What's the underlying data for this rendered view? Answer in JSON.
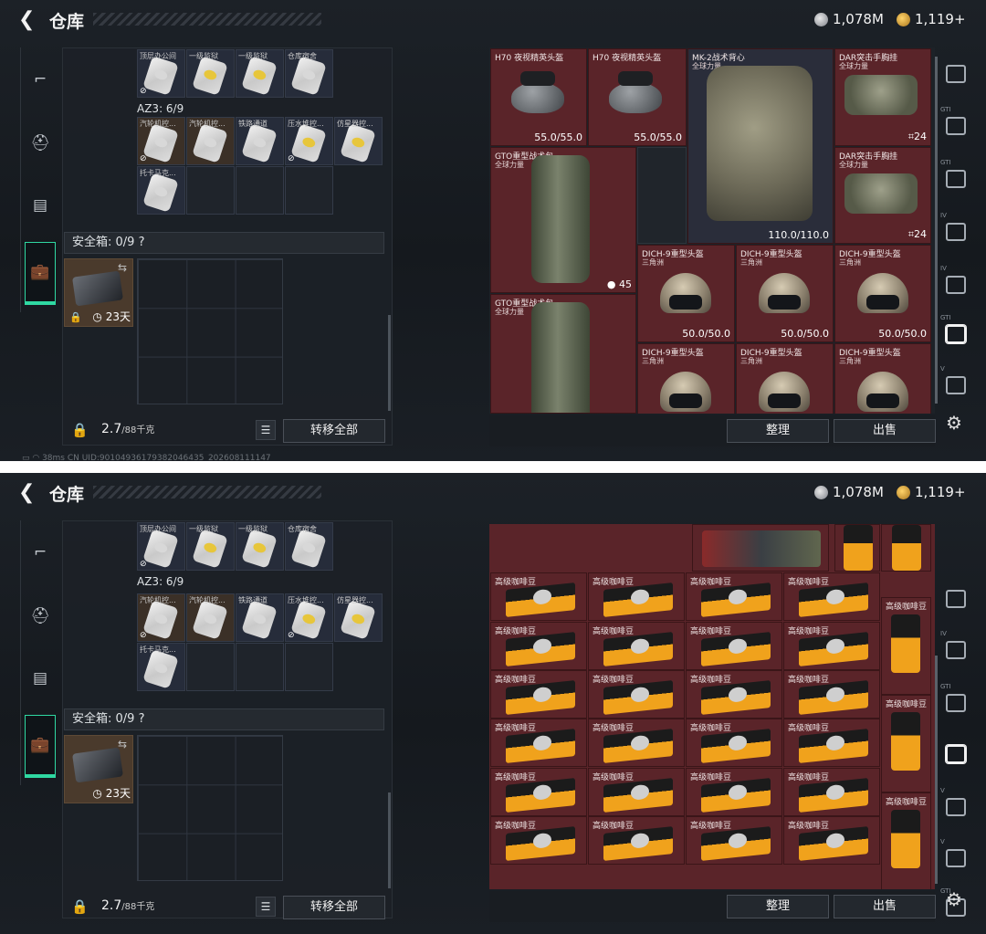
{
  "header": {
    "back_icon": "back-arrow-icon",
    "title": "仓库",
    "currency1": "1,078M",
    "currency2": "1,119+"
  },
  "sidebar": {
    "items": [
      {
        "icon": "pistol-icon"
      },
      {
        "icon": "helmet-icon"
      },
      {
        "icon": "backpack-icon"
      },
      {
        "icon": "briefcase-icon",
        "active": true
      }
    ]
  },
  "left": {
    "row0": [
      "顶层办公间",
      "一级监狱",
      "一级监狱",
      "仓库宿舍"
    ],
    "section_label": "AZ3: 6/9",
    "row1": [
      "汽轮机控...",
      "汽轮机控...",
      "铁路通道",
      "压水堆控...",
      "仿星器控..."
    ],
    "row2": [
      "托卡马克..."
    ],
    "safe_box_label": "安全箱: 0/9",
    "safe_box_help": "?",
    "safe_days": "23天",
    "weight": "2.7",
    "weight_max": "/88千克",
    "transfer_all": "转移全部"
  },
  "footer": "▭ ◠ 38ms   CN UID:9010493617938204643​5_202608111147",
  "right1": {
    "items": [
      {
        "name": "H70 夜视精英头盔",
        "dur": "55.0/55.0"
      },
      {
        "name": "H70 夜视精英头盔",
        "dur": "55.0/55.0"
      },
      {
        "name": "MK-2战术背心",
        "sub": "全球力量",
        "dur": "110.0/110.0"
      },
      {
        "name": "DAR突击手胸挂",
        "sub": "全球力量",
        "count": "24"
      },
      {
        "name": "DAR突击手胸挂",
        "sub": "全球力量",
        "count": "24"
      },
      {
        "name": "GTO重型战术包",
        "sub": "全球力量",
        "count": "45"
      },
      {
        "name": "GTO重型战术包",
        "sub": "全球力量"
      },
      {
        "name": "DICH-9重型头盔",
        "sub": "三角洲",
        "dur": "50.0/50.0"
      },
      {
        "name": "DICH-9重型头盔",
        "sub": "三角洲",
        "dur": "50.0/50.0"
      },
      {
        "name": "DICH-9重型头盔",
        "sub": "三角洲",
        "dur": "50.0/50.0"
      },
      {
        "name": "DICH-9重型头盔",
        "sub": "三角洲"
      },
      {
        "name": "DICH-9重型头盔",
        "sub": "三角洲"
      },
      {
        "name": "DICH-9重型头盔",
        "sub": "三角洲"
      }
    ]
  },
  "right2": {
    "item_name": "高级咖啡豆"
  },
  "buttons": {
    "sort": "整理",
    "sell": "出售"
  },
  "tabs": [
    {
      "label": ""
    },
    {
      "label": "GTI"
    },
    {
      "label": "GTI"
    },
    {
      "label": "IV"
    },
    {
      "label": "IV"
    },
    {
      "label": "GTI"
    },
    {
      "label": "V"
    }
  ]
}
